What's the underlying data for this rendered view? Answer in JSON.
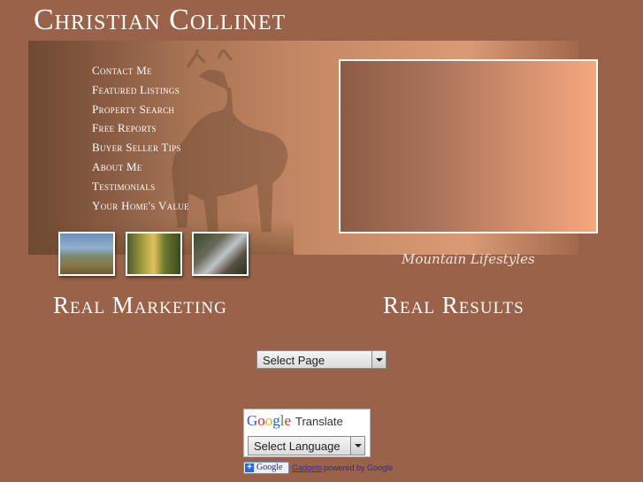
{
  "site": {
    "title": "Christian Collinet"
  },
  "nav": {
    "items": [
      "Contact Me",
      "Featured Listings",
      "Property Search",
      "Free Reports",
      "Buyer Seller Tips",
      "About Me",
      "Testimonials",
      "Your Home's Value"
    ]
  },
  "banner": {
    "tagline": "Mountain Lifestyles"
  },
  "slogans": {
    "left": "Real Marketing",
    "right": "Real Results"
  },
  "page_select": {
    "value": "Select Page"
  },
  "translate": {
    "google_word": [
      "G",
      "o",
      "o",
      "g",
      "l",
      "e"
    ],
    "label": "Translate",
    "select_value": "Select Language"
  },
  "gadgets": {
    "button_text": "Google",
    "link_text": "Gadgets",
    "powered_text": "powered by Google"
  },
  "colors": {
    "background": "#9a6248",
    "text": "#ffffff",
    "link": "#2a2ad8"
  }
}
